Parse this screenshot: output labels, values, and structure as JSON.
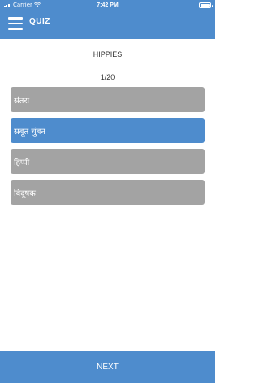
{
  "status_bar": {
    "carrier": "Carrier",
    "time": "7:42 PM",
    "battery_level": 1.0
  },
  "header": {
    "title": "QUIZ",
    "menu_icon": "hamburger-icon"
  },
  "quiz": {
    "question": "HIPPIES",
    "progress": "1/20",
    "options": [
      {
        "label": "संतरा",
        "selected": false
      },
      {
        "label": "सबूत चुंबन",
        "selected": true
      },
      {
        "label": "हिप्पी",
        "selected": false
      },
      {
        "label": "विदूषक",
        "selected": false
      }
    ]
  },
  "footer": {
    "next_label": "NEXT"
  },
  "colors": {
    "primary": "#4e8ccd",
    "option_bg": "#a3a3a3",
    "text": "#333333"
  }
}
